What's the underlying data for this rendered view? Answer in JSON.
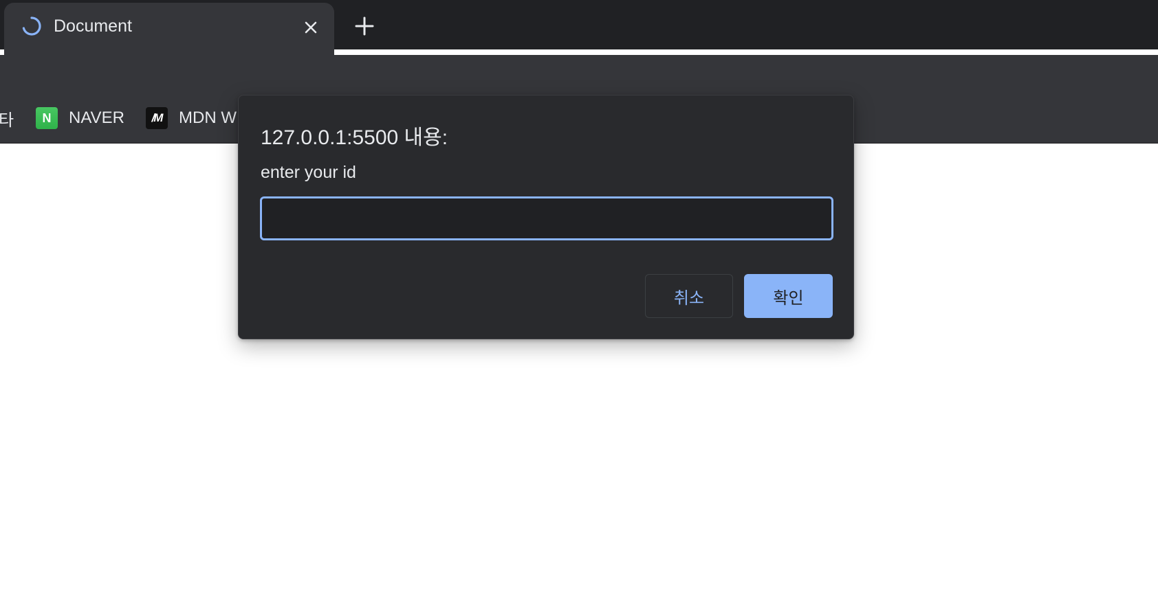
{
  "browser": {
    "tab": {
      "title": "Document",
      "icon": "loading-spinner-icon",
      "close_icon": "close-icon"
    },
    "new_tab_icon": "plus-icon",
    "bookmarks": [
      {
        "label": "타",
        "icon": null
      },
      {
        "label": "NAVER",
        "icon": "naver-icon",
        "icon_glyph": "N"
      },
      {
        "label": "MDN W",
        "icon": "mdn-icon",
        "icon_glyph": "/M"
      }
    ]
  },
  "dialog": {
    "title": "127.0.0.1:5500 내용:",
    "message": "enter your id",
    "input_value": "",
    "cancel_label": "취소",
    "ok_label": "확인"
  },
  "colors": {
    "accent": "#8ab4f8",
    "dialog_bg": "#292a2d",
    "tabstrip_bg": "#202124",
    "toolbar_bg": "#35363a"
  }
}
